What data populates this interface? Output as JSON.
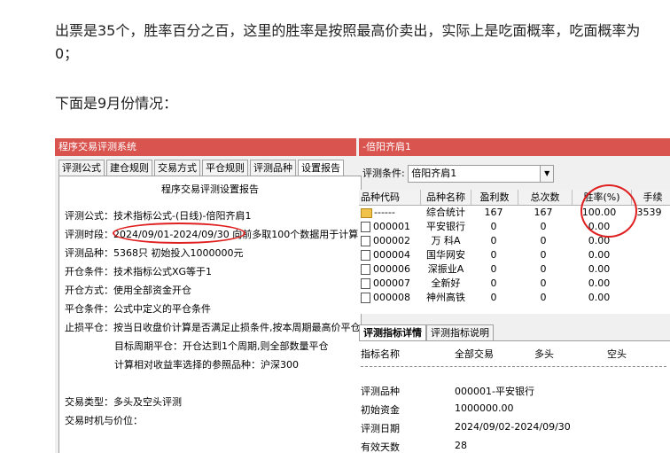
{
  "article": {
    "paragraph1": "出票是35个，胜率百分之百，这里的胜率是按照最高价卖出，实际上是吃面概率，吃面概率为0；",
    "paragraph2": "下面是9月份情况："
  },
  "left_window": {
    "title": "程序交易评测系统",
    "tabs": [
      "评测公式",
      "建仓规则",
      "交易方式",
      "平仓规则",
      "评测品种",
      "设置报告"
    ],
    "report_title": "程序交易评测设置报告",
    "lines": [
      "评测公式：技术指标公式-(日线)-倍阳齐肩1",
      "评测时段：2024/09/01-2024/09/30 向前多取100个数据用于计算",
      "评测品种：5368只 初始投入1000000元",
      "开仓条件：技术指标公式XG等于1",
      "开仓方式：使用全部资金开仓",
      "平仓条件：公式中定义的平仓条件",
      "止损平仓：按当日收盘价计算是否满足止损条件,按本周期最高价平仓"
    ],
    "indent_lines": [
      "目标周期平仓：开仓达到1个周期,则全部数量平仓",
      "计算相对收益率选择的参照品种：沪深300"
    ],
    "lines_bottom": [
      "交易类型：多头及空头评测",
      "交易时机与价位："
    ]
  },
  "right_window": {
    "title": "-倍阳齐肩1",
    "filter_label": "评测条件:",
    "filter_value": "倍阳齐肩1",
    "grid_headers": [
      "品种代码",
      "品种名称",
      "盈利数",
      "总次数",
      "胜率(%)",
      "手续"
    ],
    "grid_rows": [
      {
        "code": "------",
        "name": "综合统计",
        "win": "167",
        "total": "167",
        "rate": "100.00",
        "fee": "3539"
      },
      {
        "code": "000001",
        "name": "平安银行",
        "win": "0",
        "total": "0",
        "rate": "0.00",
        "fee": ""
      },
      {
        "code": "000002",
        "name": "万 科A",
        "win": "0",
        "total": "0",
        "rate": "0.00",
        "fee": ""
      },
      {
        "code": "000004",
        "name": "国华网安",
        "win": "0",
        "total": "0",
        "rate": "0.00",
        "fee": ""
      },
      {
        "code": "000006",
        "name": "深振业A",
        "win": "0",
        "total": "0",
        "rate": "0.00",
        "fee": ""
      },
      {
        "code": "000007",
        "name": "全新好",
        "win": "0",
        "total": "0",
        "rate": "0.00",
        "fee": ""
      },
      {
        "code": "000008",
        "name": "神州高铁",
        "win": "0",
        "total": "0",
        "rate": "0.00",
        "fee": ""
      }
    ],
    "bottom_tabs": [
      "评测指标详情",
      "评测指标说明"
    ],
    "detail_header": [
      "指标名称",
      "全部交易",
      "多头",
      "空头"
    ],
    "details": [
      {
        "label": "评测品种",
        "value": "000001-平安银行"
      },
      {
        "label": "初始资金",
        "value": "1000000.00"
      },
      {
        "label": "评测日期",
        "value": "2024/09/02-2024/09/30"
      },
      {
        "label": "有效天数",
        "value": "28"
      }
    ]
  },
  "colors": {
    "titlebar": "#d9534f",
    "annotation": "#e02020"
  }
}
